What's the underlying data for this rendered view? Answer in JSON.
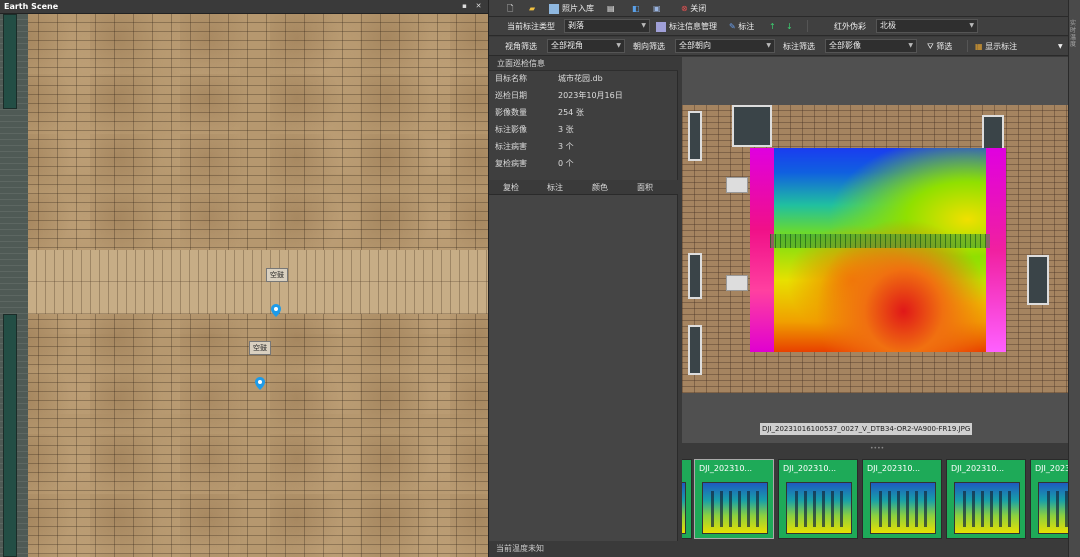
{
  "scene": {
    "title": "Earth Scene",
    "markers": [
      {
        "label": "空鼓"
      },
      {
        "label": "空鼓"
      }
    ]
  },
  "toolbar1": {
    "photo_import": "照片入库",
    "close": "关闭"
  },
  "toolbar2": {
    "annotation_type_label": "当前标注类型",
    "annotation_type_value": "剥落",
    "annotation_manage": "标注信息管理",
    "annotate": "标注",
    "infrared_label": "红外伪彩",
    "infrared_value": "北极"
  },
  "toolbar3": {
    "view_filter_label": "视角筛选",
    "view_filter_value": "全部视角",
    "direction_filter_label": "朝向筛选",
    "direction_filter_value": "全部朝向",
    "annotation_filter_label": "标注筛选",
    "annotation_filter_value": "全部影像",
    "filter_button": "筛选",
    "show_annotation": "显示标注"
  },
  "info": {
    "title": "立面巡检信息",
    "rows": [
      {
        "k": "目标名称",
        "v": "城市花园.db"
      },
      {
        "k": "巡检日期",
        "v": "2023年10月16日"
      },
      {
        "k": "影像数量",
        "v": "254 张"
      },
      {
        "k": "标注影像",
        "v": "3 张"
      },
      {
        "k": "标注病害",
        "v": "3 个"
      },
      {
        "k": "复检病害",
        "v": "0 个"
      }
    ]
  },
  "list": {
    "columns": [
      "复检",
      "标注",
      "颜色",
      "面积"
    ]
  },
  "status": "当前温度未知",
  "viewer": {
    "filename": "DJI_20231016100537_0027_V_DTB34-OR2-VA900-FR19.JPG"
  },
  "thumbnails": [
    {
      "label": "DJI_202310..."
    },
    {
      "label": "DJI_202310..."
    },
    {
      "label": "DJI_202310..."
    },
    {
      "label": "DJI_202310..."
    },
    {
      "label": "DJI_202310..."
    }
  ],
  "side_tab": "实时温度"
}
